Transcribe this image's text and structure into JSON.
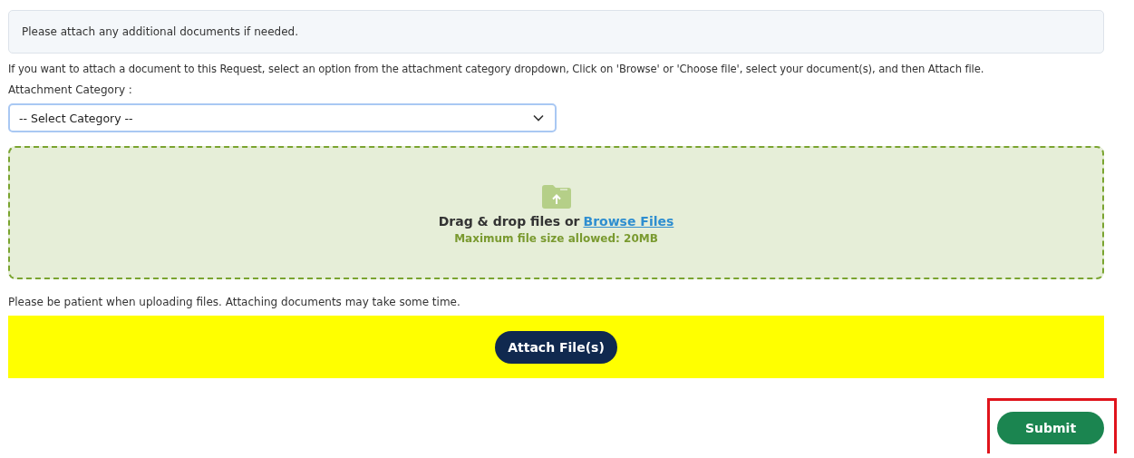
{
  "notice": "Please attach any additional documents if needed.",
  "instructions": "If you want to attach a document to this Request, select an option from the attachment category dropdown, Click on 'Browse' or 'Choose file', select your document(s), and then Attach file.",
  "category": {
    "label": "Attachment Category :",
    "value": "-- Select Category --"
  },
  "dropzone": {
    "text": "Drag & drop files or",
    "link": "Browse Files",
    "hint": "Maximum file size allowed: 20MB"
  },
  "patience_note": "Please be patient when uploading files. Attaching documents may take some time.",
  "attach_button": "Attach File(s)",
  "submit_button": {
    "label": "Submit",
    "highlighted": true
  }
}
